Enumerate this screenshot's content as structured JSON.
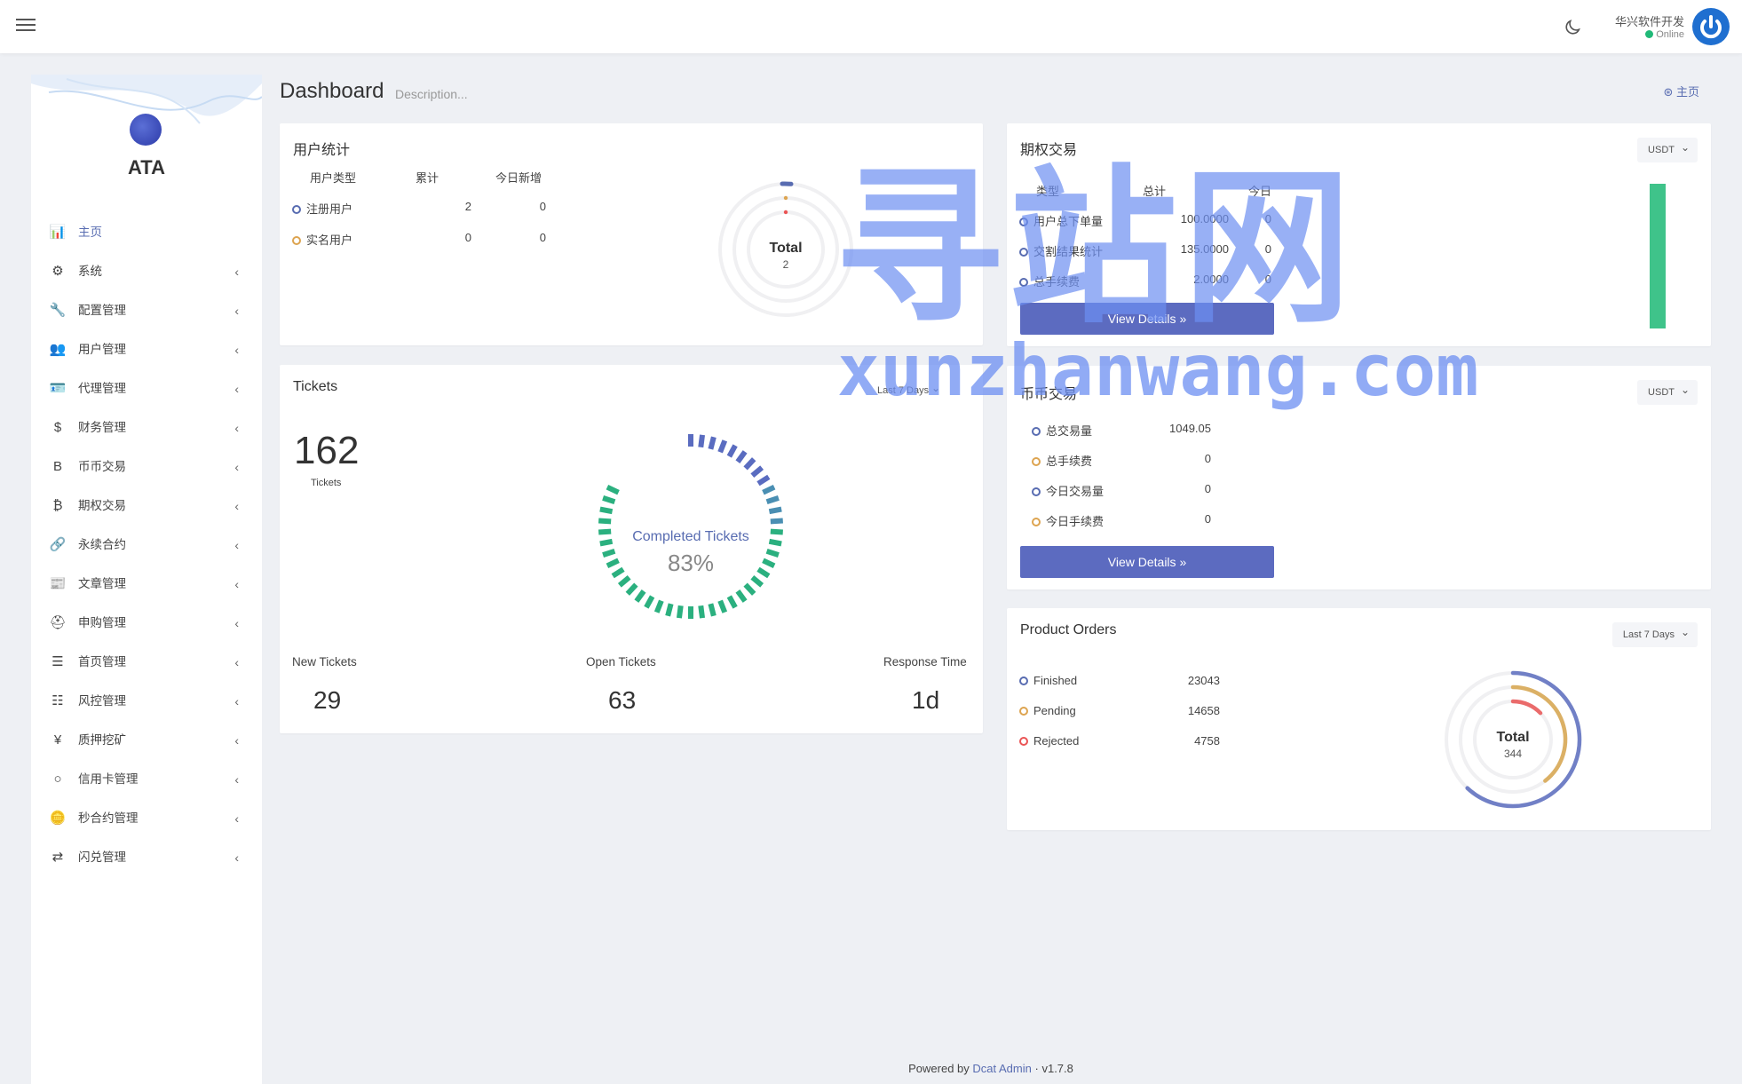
{
  "topbar": {
    "user_name": "华兴软件开发",
    "user_status": "Online"
  },
  "sidebar": {
    "brand": "ATA",
    "items": [
      {
        "icon": "bar-chart-icon",
        "glyph": "📊",
        "label": "主页",
        "active": true
      },
      {
        "icon": "gear-icon",
        "glyph": "⚙",
        "label": "系统"
      },
      {
        "icon": "wrench-icon",
        "glyph": "🔧",
        "label": "配置管理"
      },
      {
        "icon": "users-icon",
        "glyph": "👥",
        "label": "用户管理"
      },
      {
        "icon": "id-card-icon",
        "glyph": "🪪",
        "label": "代理管理"
      },
      {
        "icon": "dollar-icon",
        "glyph": "$",
        "label": "财务管理"
      },
      {
        "icon": "bitcoin-b-icon",
        "glyph": "B",
        "label": "币币交易"
      },
      {
        "icon": "bitcoin-icon",
        "glyph": "₿",
        "label": "期权交易"
      },
      {
        "icon": "link-icon",
        "glyph": "🔗",
        "label": "永续合约"
      },
      {
        "icon": "newspaper-icon",
        "glyph": "📰",
        "label": "文章管理"
      },
      {
        "icon": "lifebuoy-icon",
        "glyph": "⛑",
        "label": "申购管理"
      },
      {
        "icon": "list-icon",
        "glyph": "☰",
        "label": "首页管理"
      },
      {
        "icon": "list-ul-icon",
        "glyph": "☷",
        "label": "风控管理"
      },
      {
        "icon": "yen-icon",
        "glyph": "¥",
        "label": "质押挖矿"
      },
      {
        "icon": "circle-icon",
        "glyph": "○",
        "label": "信用卡管理"
      },
      {
        "icon": "coins-icon",
        "glyph": "🪙",
        "label": "秒合约管理"
      },
      {
        "icon": "exchange-icon",
        "glyph": "⇄",
        "label": "闪兑管理"
      }
    ]
  },
  "page": {
    "title": "Dashboard",
    "description": "Description...",
    "breadcrumb": "主页"
  },
  "user_stats": {
    "title": "用户统计",
    "headers": [
      "用户类型",
      "累计",
      "今日新增"
    ],
    "rows": [
      {
        "type": "注册用户",
        "total": "2",
        "today": "0"
      },
      {
        "type": "实名用户",
        "total": "0",
        "today": "0"
      }
    ],
    "chart_total_label": "Total",
    "chart_total_value": "2"
  },
  "options_trade": {
    "title": "期权交易",
    "currency": "USDT",
    "headers": [
      "类型",
      "总计",
      "今日"
    ],
    "rows": [
      {
        "type": "用户总下单量",
        "total": "100.0000",
        "today": "0"
      },
      {
        "type": "交割结果统计",
        "total": "135.0000",
        "today": "0"
      },
      {
        "type": "总手续费",
        "total": "2.0000",
        "today": "0"
      }
    ],
    "button": "View Details"
  },
  "tickets": {
    "title": "Tickets",
    "range": "Last 7 Days",
    "count": "162",
    "count_label": "Tickets",
    "gauge_label": "Completed Tickets",
    "gauge_value": "83%",
    "gauge_fraction": 0.83,
    "stats": [
      {
        "label": "New Tickets",
        "value": "29"
      },
      {
        "label": "Open Tickets",
        "value": "63"
      },
      {
        "label": "Response Time",
        "value": "1d"
      }
    ]
  },
  "coin_trade": {
    "title": "币币交易",
    "currency": "USDT",
    "rows": [
      {
        "label": "总交易量",
        "value": "1049.05",
        "color": "blue"
      },
      {
        "label": "总手续费",
        "value": "0",
        "color": "yellow"
      },
      {
        "label": "今日交易量",
        "value": "0",
        "color": "blue"
      },
      {
        "label": "今日手续费",
        "value": "0",
        "color": "yellow"
      }
    ],
    "button": "View Details"
  },
  "product_orders": {
    "title": "Product Orders",
    "range": "Last 7 Days",
    "rows": [
      {
        "label": "Finished",
        "value": "23043",
        "color": "blue"
      },
      {
        "label": "Pending",
        "value": "14658",
        "color": "yellow"
      },
      {
        "label": "Rejected",
        "value": "4758",
        "color": "red"
      }
    ],
    "chart_total_label": "Total",
    "chart_total_value": "344"
  },
  "watermark": {
    "cn": "寻站网",
    "en": "xunzhanwang.com"
  },
  "footer": {
    "prefix": "Powered by",
    "link": "Dcat Admin",
    "version": "v1.7.8"
  },
  "colors": {
    "primary": "#586cb1",
    "button": "#5c6bc0",
    "green": "#21b978",
    "yellow": "#dda450",
    "red": "#ea5455",
    "bar_green": "#3fc38a"
  }
}
